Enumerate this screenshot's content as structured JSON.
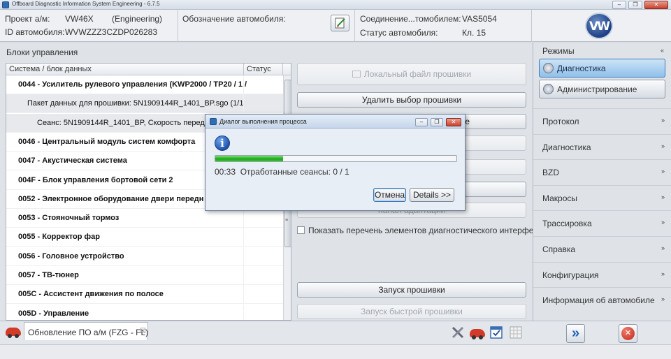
{
  "window": {
    "title": "Offboard Diagnostic Information System Engineering - 6.7.5",
    "minimize": "–",
    "restore": "❐",
    "close": "✕"
  },
  "header": {
    "project_label": "Проект а/м:",
    "project_value": "VW46X",
    "project_mode": "(Engineering)",
    "vin_label": "ID автомобиля:",
    "vin_value": "WVWZZZ3CZDP026283",
    "designation_label": "Обозначение автомобиля:",
    "connection_label": "Соединение...томобилем:",
    "connection_value": "VAS5054",
    "vehicle_status_label": "Статус автомобиля:",
    "vehicle_status_value": "Кл. 15",
    "logo_text": "VW"
  },
  "left_panel": {
    "title": "Блоки управления",
    "columns": [
      "Система / блок данных",
      "Статус"
    ],
    "rows": [
      {
        "text": "0044 - Усилитель рулевого управления  (KWP2000 / TP20 / 1 /",
        "bold": true,
        "indent": 0
      },
      {
        "text": "Пакет данных для прошивки: 5N1909144R_1401_BP.sgo (1/1",
        "bold": false,
        "indent": 1
      },
      {
        "text": "Сеанс: 5N1909144R_1401_BP, Скорость перед",
        "bold": false,
        "indent": 2
      },
      {
        "text": "0046 - Центральный модуль систем комфорта",
        "bold": true,
        "indent": 0
      },
      {
        "text": "0047 - Акустическая система",
        "bold": true,
        "indent": 0
      },
      {
        "text": "004F - Блок управления бортовой сети 2",
        "bold": true,
        "indent": 0
      },
      {
        "text": "0052 - Электронное оборудование двери передн",
        "bold": true,
        "indent": 0
      },
      {
        "text": "0053 - Стояночный тормоз",
        "bold": true,
        "indent": 0
      },
      {
        "text": "0055 - Корректор фар",
        "bold": true,
        "indent": 0
      },
      {
        "text": "0056 - Головное устройство",
        "bold": true,
        "indent": 0
      },
      {
        "text": "0057 - ТВ-тюнер",
        "bold": true,
        "indent": 0
      },
      {
        "text": "005C - Ассистент движения по полосе",
        "bold": true,
        "indent": 0
      },
      {
        "text": "005D - Управление",
        "bold": true,
        "indent": 0
      }
    ],
    "scroll_grip": "≡",
    "buttons": {
      "local_file": "Локальный файл прошивки",
      "remove_selection": "Удалить выбор прошивки",
      "partial_e": "е",
      "channel_adapt": "Канал адаптации",
      "show_list": "Показать перечень элементов диагностического интерфейса",
      "start_flash": "Запуск прошивки",
      "start_quick_flash": "Запуск быстрой прошивки"
    }
  },
  "sidebar": {
    "modes_title": "Режимы",
    "modes": [
      {
        "label": "Диагностика",
        "active": true
      },
      {
        "label": "Администрирование",
        "active": false
      }
    ],
    "items": [
      "Протокол",
      "Диагностика",
      "BZD",
      "Макросы",
      "Трассировка",
      "Справка",
      "Конфигурация",
      "Информация об автомобиле"
    ],
    "chevron_up": "«",
    "chevron_down": "»"
  },
  "bottom": {
    "tab_label": "Обновление ПО а/м (FZG - FL)",
    "tab_close": "☒",
    "next_icon": "»",
    "close_icon": "✕"
  },
  "dialog": {
    "title": "Диалог выполнения процесса",
    "info_glyph": "i",
    "progress": 0.28,
    "time": "00:33",
    "status": "Отработанные сеансы: 0 / 1",
    "cancel": "Отмена",
    "details": "Details >>",
    "colors": {
      "progress": "#2bb627"
    }
  }
}
